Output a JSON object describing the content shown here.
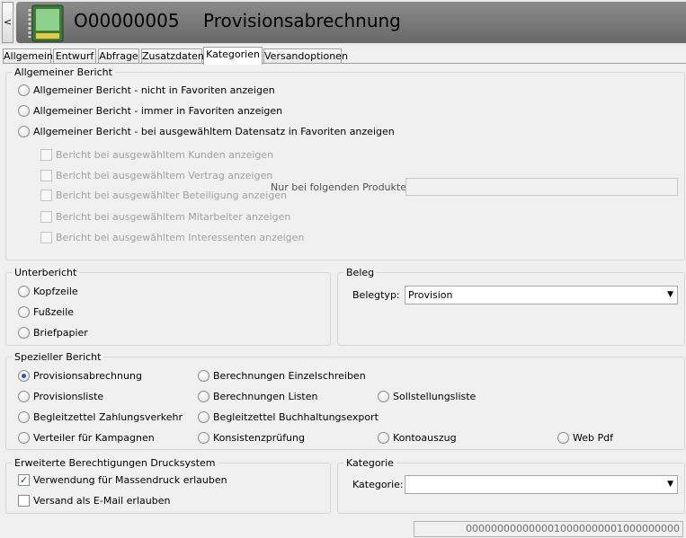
{
  "header": {
    "back_label": "<",
    "record_id": "O00000005",
    "title": "Provisionsabrechnung"
  },
  "tabs": [
    {
      "label": "Allgemein",
      "active": false
    },
    {
      "label": "Entwurf",
      "active": false
    },
    {
      "label": "Abfrage",
      "active": false
    },
    {
      "label": "Zusatzdaten",
      "active": false
    },
    {
      "label": "Kategorien",
      "active": true
    },
    {
      "label": "Versandoptionen",
      "active": false
    }
  ],
  "general_report": {
    "legend": "Allgemeiner Bericht",
    "options": [
      {
        "label": "Allgemeiner Bericht - nicht in Favoriten anzeigen",
        "selected": false
      },
      {
        "label": "Allgemeiner Bericht - immer in Favoriten anzeigen",
        "selected": false
      },
      {
        "label": "Allgemeiner Bericht - bei ausgewähltem Datensatz in Favoriten anzeigen",
        "selected": false
      }
    ],
    "checkboxes": [
      {
        "label": "Bericht bei ausgewähltem Kunden anzeigen",
        "checked": false
      },
      {
        "label": "Bericht bei ausgewähltem Vertrag anzeigen",
        "checked": false
      },
      {
        "label": "Bericht bei ausgewählter Beteiligung anzeigen",
        "checked": false
      },
      {
        "label": "Bericht bei ausgewähltem Mitarbeiter anzeigen",
        "checked": false
      },
      {
        "label": "Bericht bei ausgewähltem Interessenten anzeigen",
        "checked": false
      }
    ],
    "products_label": "Nur bei folgenden Produkten:",
    "products_value": ""
  },
  "sub_report": {
    "legend": "Unterbericht",
    "options": [
      {
        "label": "Kopfzeile",
        "selected": false
      },
      {
        "label": "Fußzeile",
        "selected": false
      },
      {
        "label": "Briefpapier",
        "selected": false
      }
    ]
  },
  "voucher": {
    "legend": "Beleg",
    "type_label": "Belegtyp:",
    "type_value": "Provision"
  },
  "special_report": {
    "legend": "Spezieller Bericht",
    "options": [
      {
        "label": "Provisionsabrechnung",
        "selected": true
      },
      {
        "label": "Berechnungen Einzelschreiben",
        "selected": false
      },
      {
        "label": "Provisionsliste",
        "selected": false
      },
      {
        "label": "Berechnungen Listen",
        "selected": false
      },
      {
        "label": "Sollstellungsliste",
        "selected": false
      },
      {
        "label": "Begleitzettel Zahlungsverkehr",
        "selected": false
      },
      {
        "label": "Begleitzettel Buchhaltungsexport",
        "selected": false
      },
      {
        "label": "Verteiler für Kampagnen",
        "selected": false
      },
      {
        "label": "Konsistenzprüfung",
        "selected": false
      },
      {
        "label": "Kontoauszug",
        "selected": false
      },
      {
        "label": "Web Pdf",
        "selected": false
      }
    ]
  },
  "permissions": {
    "legend": "Erweiterte Berechtigungen Drucksystem",
    "checkboxes": [
      {
        "label": "Verwendung für Massendruck erlauben",
        "checked": true
      },
      {
        "label": "Versand als E-Mail erlauben",
        "checked": false
      }
    ]
  },
  "category": {
    "legend": "Kategorie",
    "label": "Kategorie:",
    "value": ""
  },
  "status_code": "0000000000000010000000001000000000",
  "icons": {
    "app": "report-document-icon",
    "dropdown": "chevron-down-icon",
    "check": "checkmark-icon"
  }
}
